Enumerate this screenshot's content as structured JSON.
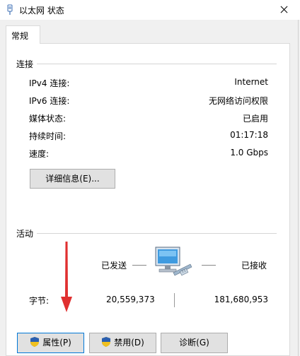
{
  "window": {
    "title": "以太网 状态"
  },
  "tabs": [
    {
      "label": "常规"
    }
  ],
  "connection": {
    "section_label": "连接",
    "rows": [
      {
        "label": "IPv4 连接:",
        "value": "Internet"
      },
      {
        "label": "IPv6 连接:",
        "value": "无网络访问权限"
      },
      {
        "label": "媒体状态:",
        "value": "已启用"
      },
      {
        "label": "持续时间:",
        "value": "01:17:18"
      },
      {
        "label": "速度:",
        "value": "1.0 Gbps"
      }
    ],
    "details_button": "详细信息(E)..."
  },
  "activity": {
    "section_label": "活动",
    "sent_label": "已发送",
    "received_label": "已接收",
    "bytes_label": "字节:",
    "bytes_sent": "20,559,373",
    "bytes_received": "181,680,953"
  },
  "buttons": {
    "properties": "属性(P)",
    "disable": "禁用(D)",
    "diagnose": "诊断(G)"
  },
  "icons": {
    "title": "network-adapter-icon",
    "shield": "uac-shield-icon",
    "network": "network-computer-icon",
    "annotation": "red-arrow-annotation"
  },
  "colors": {
    "accent_border": "#0078d7",
    "annotation_red": "#e03030"
  }
}
